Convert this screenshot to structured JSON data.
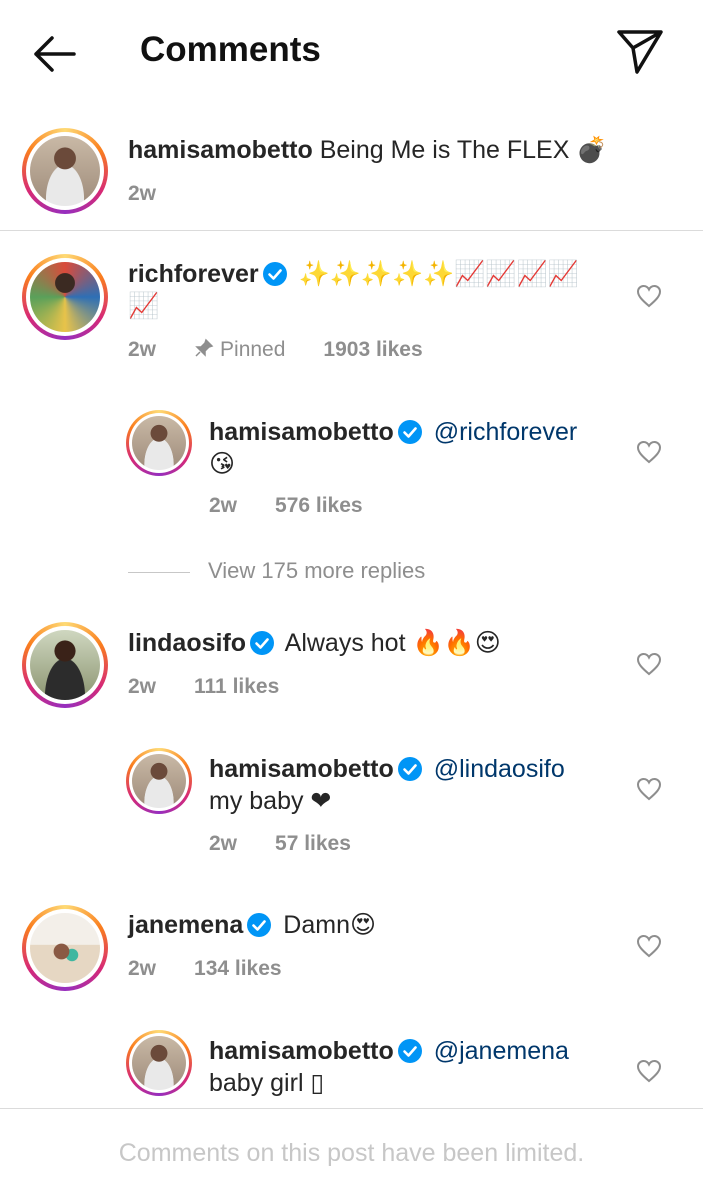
{
  "header": {
    "title": "Comments",
    "back_icon": "arrow-left-icon",
    "send_icon": "paper-plane-icon"
  },
  "caption": {
    "username": "hamisamobetto",
    "text": "Being Me is The FLEX 💣",
    "time": "2w"
  },
  "comments": [
    {
      "username": "richforever",
      "verified": true,
      "text": "✨✨✨✨✨📈📈📈📈📈",
      "time": "2w",
      "pinned": "Pinned",
      "likes": "1903 likes",
      "replies": [
        {
          "username": "hamisamobetto",
          "verified": true,
          "mention": "@richforever",
          "text": "😘",
          "time": "2w",
          "likes": "576 likes"
        }
      ],
      "view_more": "View 175 more replies"
    },
    {
      "username": "lindaosifo",
      "verified": true,
      "text": "Always hot 🔥🔥😍",
      "time": "2w",
      "likes": "111 likes",
      "replies": [
        {
          "username": "hamisamobetto",
          "verified": true,
          "mention": "@lindaosifo",
          "text": "my baby ❤",
          "time": "2w",
          "likes": "57 likes"
        }
      ]
    },
    {
      "username": "janemena",
      "verified": true,
      "text": "Damn😍",
      "time": "2w",
      "likes": "134 likes",
      "replies": [
        {
          "username": "hamisamobetto",
          "verified": true,
          "mention": "@janemena",
          "text": "baby girl ▯"
        }
      ]
    }
  ],
  "footer": {
    "text": "Comments on this post have been limited."
  },
  "colors": {
    "verified": "#0095f6",
    "mention": "#00376b",
    "muted": "#8e8e8e"
  }
}
